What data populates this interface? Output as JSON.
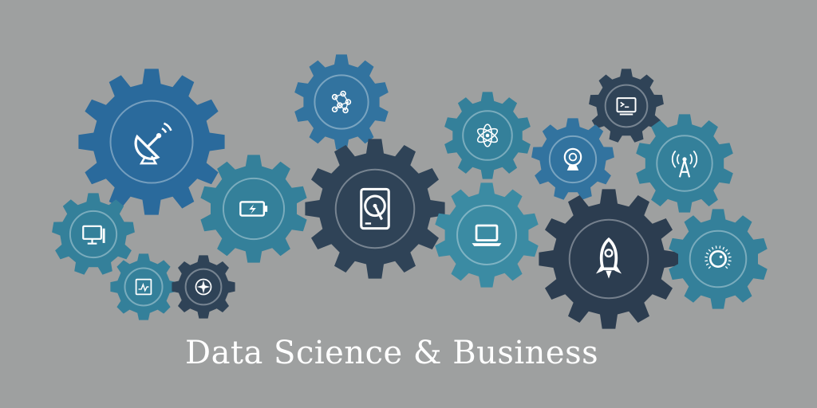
{
  "caption": "Data Science & Business",
  "colors": {
    "background": "#9ea0a0",
    "blue_dark": "#2a6a9c",
    "blue": "#32739f",
    "teal": "#34809a",
    "teal_light": "#3b8ba3",
    "slate": "#2f4357",
    "slate_dark": "#2c3d50",
    "caption_text": "#ffffff"
  },
  "gears": [
    {
      "icon": "satellite-dish-icon",
      "color": "blue_dark"
    },
    {
      "icon": "network-cluster-icon",
      "color": "blue"
    },
    {
      "icon": "battery-icon",
      "color": "teal"
    },
    {
      "icon": "hard-drive-icon",
      "color": "slate"
    },
    {
      "icon": "desktop-computer-icon",
      "color": "teal"
    },
    {
      "icon": "circuit-board-icon",
      "color": "teal"
    },
    {
      "icon": "compass-icon",
      "color": "slate"
    },
    {
      "icon": "atom-icon",
      "color": "teal"
    },
    {
      "icon": "terminal-icon",
      "color": "slate"
    },
    {
      "icon": "webcam-icon",
      "color": "blue"
    },
    {
      "icon": "signal-tower-icon",
      "color": "teal"
    },
    {
      "icon": "laptop-icon",
      "color": "teal_light"
    },
    {
      "icon": "rocket-icon",
      "color": "slate_dark"
    },
    {
      "icon": "control-dial-icon",
      "color": "teal"
    }
  ]
}
